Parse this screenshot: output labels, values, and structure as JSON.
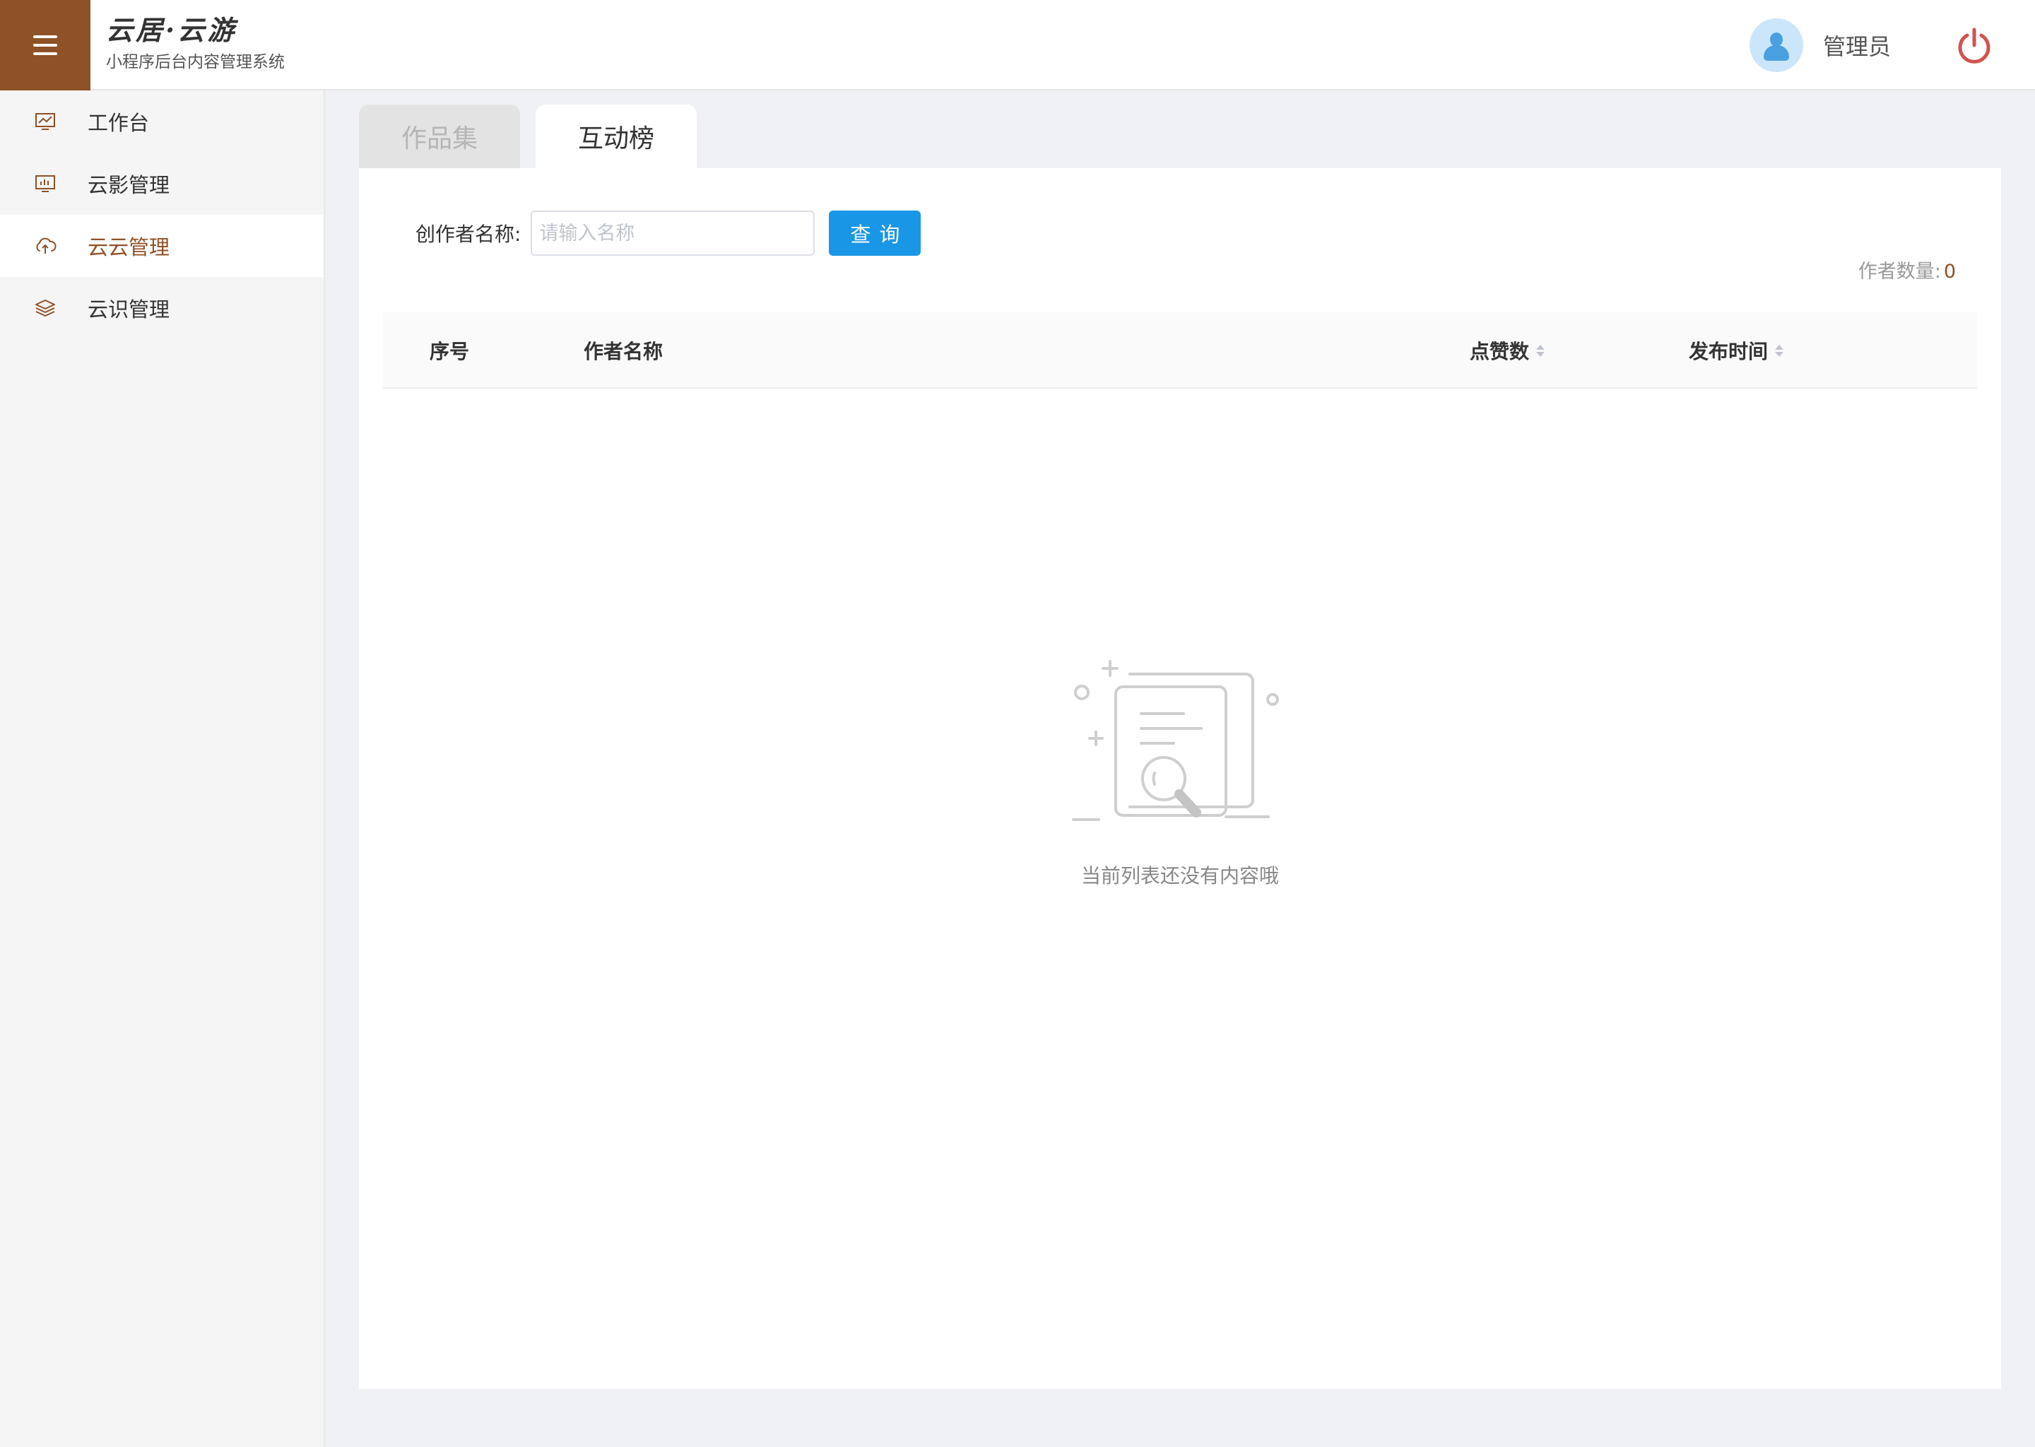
{
  "header": {
    "brand_title": "云居·云游",
    "brand_subtitle": "小程序后台内容管理系统",
    "user_name": "管理员",
    "menu_icon": "hamburger-icon",
    "power_icon": "power-icon",
    "brand_color": "#8f5127"
  },
  "sidebar": {
    "items": [
      {
        "label": "工作台",
        "icon": "line-chart-icon",
        "active": false
      },
      {
        "label": "云影管理",
        "icon": "bar-chart-icon",
        "active": false
      },
      {
        "label": "云云管理",
        "icon": "cloud-upload-icon",
        "active": true
      },
      {
        "label": "云识管理",
        "icon": "layers-icon",
        "active": false
      }
    ]
  },
  "tabs": [
    {
      "label": "作品集",
      "active": false
    },
    {
      "label": "互动榜",
      "active": true
    }
  ],
  "search": {
    "label": "创作者名称:",
    "placeholder": "请输入名称",
    "value": "",
    "button_label": "查询",
    "button_color": "#1a96e6"
  },
  "summary": {
    "count_label": "作者数量:",
    "count_value": "0"
  },
  "table": {
    "columns": [
      {
        "label": "序号",
        "sortable": false
      },
      {
        "label": "作者名称",
        "sortable": false
      },
      {
        "label": "点赞数",
        "sortable": true
      },
      {
        "label": "发布时间",
        "sortable": true
      }
    ],
    "rows": []
  },
  "empty_state": {
    "icon": "empty-document-search-icon",
    "text": "当前列表还没有内容哦"
  }
}
